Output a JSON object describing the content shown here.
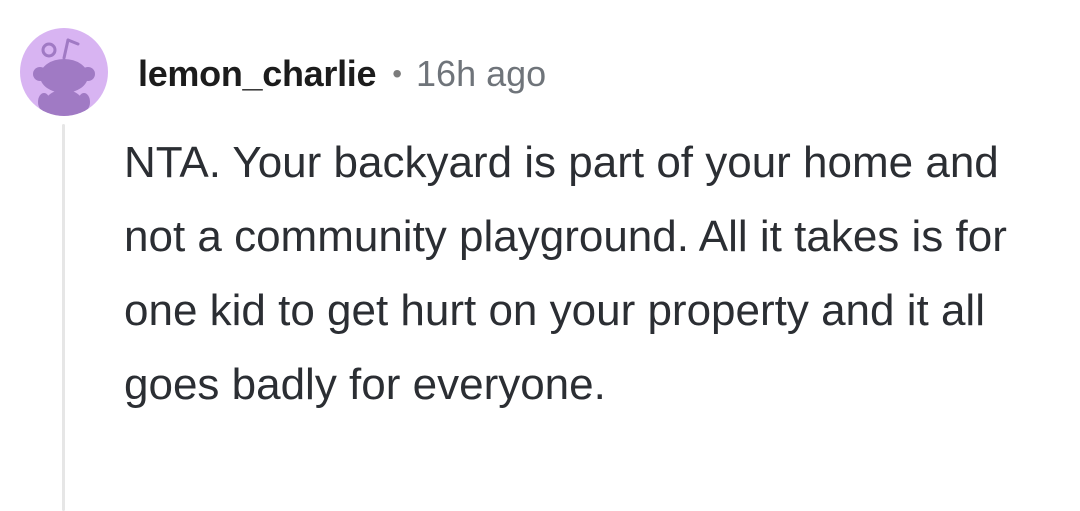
{
  "comment": {
    "username": "lemon_charlie",
    "separator": "•",
    "timestamp": "16h ago",
    "body": "NTA. Your backyard is part of your home and not a community playground. All it takes is for one kid to get hurt on your property and it all goes badly for everyone.",
    "avatar_icon": "snoo-avatar-icon"
  },
  "colors": {
    "avatar_bg": "#d8b4f2",
    "avatar_figure": "#a07ac4",
    "thread_line": "#e6e6e6",
    "username": "#1c1c1c",
    "timestamp": "#6f747a",
    "body_text": "#2b2e33"
  }
}
